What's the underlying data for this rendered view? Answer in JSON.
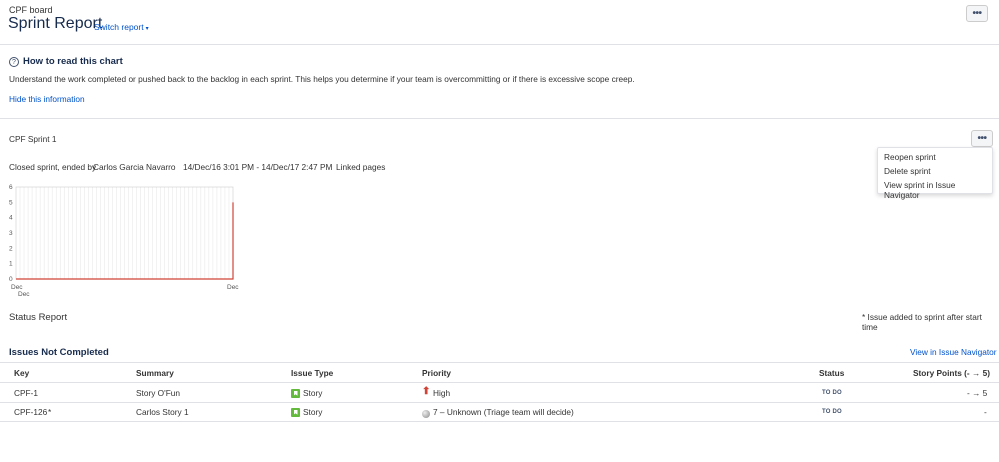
{
  "header": {
    "board_name": "CPF board",
    "title": "Sprint Report",
    "switch_report_label": "Switch report",
    "more_label": "•••"
  },
  "help": {
    "title": "How to read this chart",
    "description": "Understand the work completed or pushed back to the backlog in each sprint. This helps you determine if your team is overcommitting or if there is excessive scope creep.",
    "hide_label": "Hide this information"
  },
  "sprint": {
    "name": "CPF Sprint 1",
    "closed_prefix": "Closed sprint, ended by",
    "ended_by": "Carlos Garcia Navarro",
    "dates": "14/Dec/16 3:01 PM - 14/Dec/17 2:47 PM",
    "linked_pages": "Linked pages",
    "menu": [
      "Reopen sprint",
      "Delete sprint",
      "View sprint in Issue Navigator"
    ]
  },
  "chart_data": {
    "type": "line",
    "y_ticks": [
      "6",
      "5",
      "4",
      "3",
      "2",
      "1",
      "0"
    ],
    "x_ticks": [
      "Dec",
      "Dec",
      "Dec"
    ],
    "ylim": [
      0,
      6
    ],
    "grid": true,
    "series": [
      {
        "color": "#d04437",
        "points": [
          [
            0,
            0
          ],
          [
            1,
            0
          ],
          [
            1,
            5
          ]
        ]
      }
    ]
  },
  "status": {
    "title": "Status Report",
    "note": "* Issue added to sprint after start time"
  },
  "issues_not_completed": {
    "title": "Issues Not Completed",
    "view_link": "View in Issue Navigator",
    "columns": [
      "Key",
      "Summary",
      "Issue Type",
      "Priority",
      "Status",
      "Story Points (- → 5)"
    ],
    "rows": [
      {
        "key": "CPF-1",
        "added_mark": "",
        "summary": "Story O'Fun",
        "type": "Story",
        "priority": "High",
        "priority_icon": "arrow-up-icon",
        "status": "TO DO",
        "points": "- → 5"
      },
      {
        "key": "CPF-126",
        "added_mark": "*",
        "summary": "Carlos Story 1",
        "type": "Story",
        "priority": "7 – Unknown (Triage team will decide)",
        "priority_icon": "unknown-priority-icon",
        "status": "TO DO",
        "points": "-"
      }
    ]
  }
}
